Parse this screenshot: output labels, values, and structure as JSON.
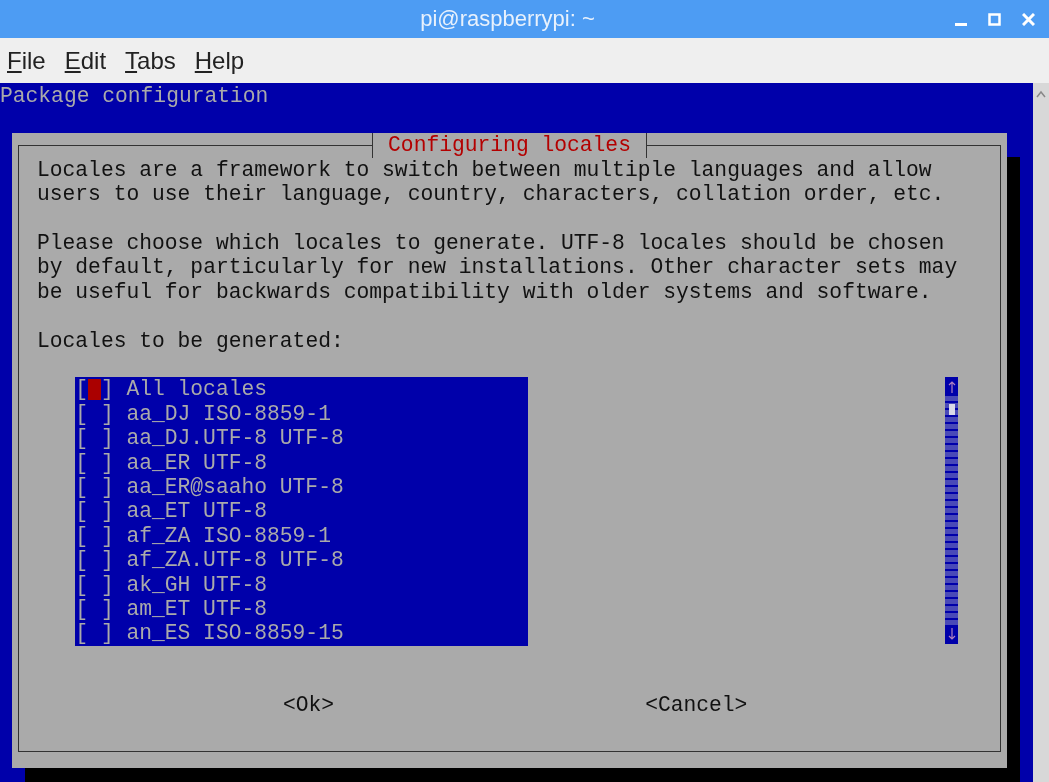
{
  "window": {
    "title": "pi@raspberrypi: ~"
  },
  "menu": [
    {
      "label": "File"
    },
    {
      "label": "Edit"
    },
    {
      "label": "Tabs"
    },
    {
      "label": "Help"
    }
  ],
  "terminal": {
    "header": "Package configuration"
  },
  "dialog": {
    "title": "Configuring locales",
    "paragraphs": [
      "Locales are a framework to switch between multiple languages and allow users to use their language, country, characters, collation order, etc.",
      "Please choose which locales to generate. UTF-8 locales should be chosen by default, particularly for new installations. Other character sets may be useful for backwards compatibility with older systems and software."
    ],
    "list_label": "Locales to be generated:",
    "items": [
      {
        "box": "[ ]",
        "label": "All locales",
        "checked": false,
        "focused": true
      },
      {
        "box": "[ ]",
        "label": "aa_DJ ISO-8859-1",
        "checked": false,
        "focused": false
      },
      {
        "box": "[ ]",
        "label": "aa_DJ.UTF-8 UTF-8",
        "checked": false,
        "focused": false
      },
      {
        "box": "[ ]",
        "label": "aa_ER UTF-8",
        "checked": false,
        "focused": false
      },
      {
        "box": "[ ]",
        "label": "aa_ER@saaho UTF-8",
        "checked": false,
        "focused": false
      },
      {
        "box": "[ ]",
        "label": "aa_ET UTF-8",
        "checked": false,
        "focused": false
      },
      {
        "box": "[ ]",
        "label": "af_ZA ISO-8859-1",
        "checked": false,
        "focused": false
      },
      {
        "box": "[ ]",
        "label": "af_ZA.UTF-8 UTF-8",
        "checked": false,
        "focused": false
      },
      {
        "box": "[ ]",
        "label": "ak_GH UTF-8",
        "checked": false,
        "focused": false
      },
      {
        "box": "[ ]",
        "label": "am_ET UTF-8",
        "checked": false,
        "focused": false
      },
      {
        "box": "[ ]",
        "label": "an_ES ISO-8859-15",
        "checked": false,
        "focused": false
      }
    ],
    "buttons": [
      {
        "label": "<Ok>"
      },
      {
        "label": "<Cancel>"
      }
    ]
  }
}
